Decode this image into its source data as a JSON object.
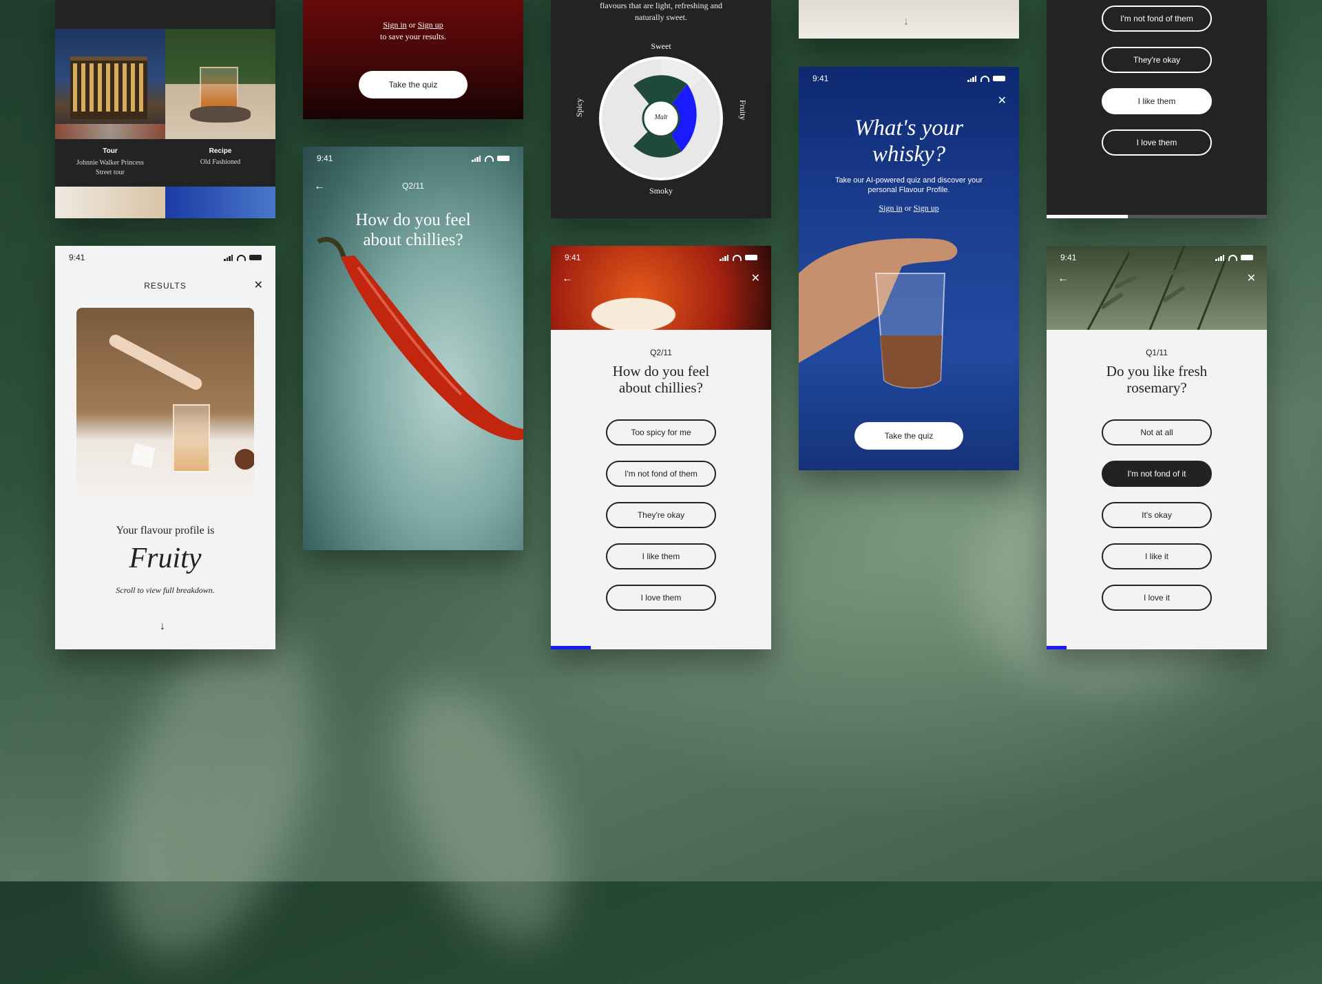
{
  "status_time": "9:41",
  "card_tour": {
    "label1": "Tour",
    "value1": "Johnnie Walker Princess Street tour",
    "label2": "Recipe",
    "value2": "Old Fashioned"
  },
  "card_signin": {
    "sign_in": "Sign in",
    "or": "or",
    "sign_up": "Sign up",
    "line2": "to save your results.",
    "cta": "Take the quiz"
  },
  "card_chilli_hero": {
    "progress": "Q2/11",
    "title": "How do you feel about chillies?"
  },
  "card_wheel": {
    "caption": "flavours that are light, refreshing and naturally sweet.",
    "axes": {
      "top": "Sweet",
      "left": "Spicy",
      "right": "Fruity",
      "bottom": "Smoky"
    },
    "center_logo": "Malt"
  },
  "card_results": {
    "header": "RESULTS",
    "intro": "Your flavour profile is",
    "profile": "Fruity",
    "hint": "Scroll to view full breakdown."
  },
  "card_chilli_quiz": {
    "progress": "Q2/11",
    "title": "How do you feel about chillies?",
    "options": [
      "Too spicy for me",
      "I'm not fond of them",
      "They're okay",
      "I like them",
      "I love them"
    ],
    "progress_fraction": 0.18
  },
  "card_landing": {
    "title": "What's your whisky?",
    "subtitle": "Take our AI-powered quiz and discover your personal Flavour Profile.",
    "sign_in": "Sign in",
    "or": "or",
    "sign_up": "Sign up",
    "cta": "Take the quiz"
  },
  "card_dark_options": {
    "options": [
      "I'm not fond of them",
      "They're okay",
      "I like them",
      "I love them"
    ],
    "selected_index": 2,
    "progress_fraction": 0.37
  },
  "card_rosemary": {
    "progress": "Q1/11",
    "title": "Do you like fresh rosemary?",
    "options": [
      "Not at all",
      "I'm not fond of it",
      "It's okay",
      "I like it",
      "I love it"
    ],
    "selected_index": 1,
    "progress_fraction": 0.09
  },
  "colors": {
    "accent_blue": "#1a1aff",
    "dark": "#232323",
    "wine": "#5a0808",
    "wheel_green": "#1f4a3a"
  }
}
